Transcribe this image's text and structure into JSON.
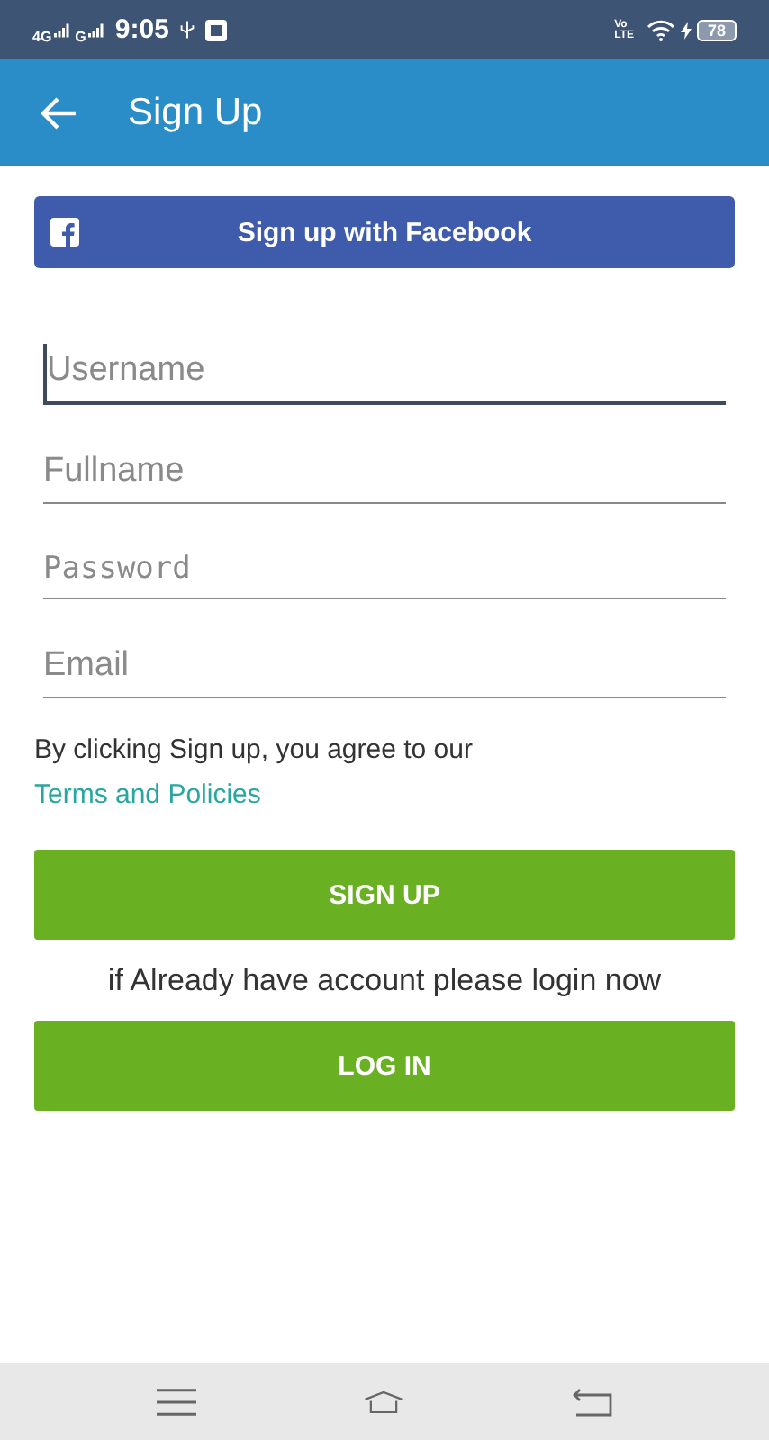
{
  "status_bar": {
    "network_1": "4G",
    "network_2": "G",
    "time": "9:05",
    "volte_1": "Vo",
    "volte_2": "LTE",
    "battery": "78"
  },
  "app_bar": {
    "title": "Sign Up"
  },
  "facebook_button": {
    "label": "Sign up with Facebook"
  },
  "fields": [
    {
      "placeholder": "Username",
      "kind": "text",
      "focused": true
    },
    {
      "placeholder": "Fullname",
      "kind": "text",
      "focused": false
    },
    {
      "placeholder": "Password",
      "kind": "password",
      "focused": false
    },
    {
      "placeholder": "Email",
      "kind": "email",
      "focused": false
    }
  ],
  "agreement": {
    "text": "By clicking Sign up, you agree to our",
    "link": "Terms and Policies"
  },
  "signup_button": {
    "label": "SIGN UP"
  },
  "login_hint": "if Already have account please login now",
  "login_button": {
    "label": "LOG IN"
  }
}
